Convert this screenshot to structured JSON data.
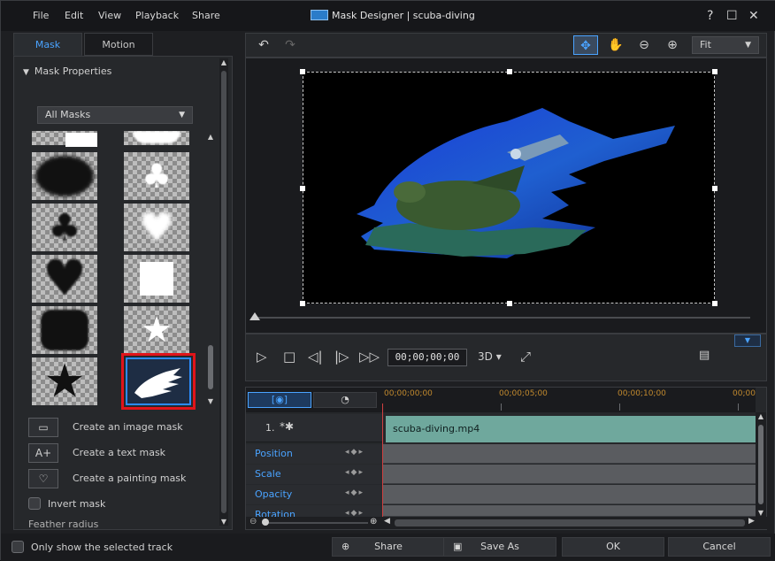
{
  "menu": {
    "file": "File",
    "edit": "Edit",
    "view": "View",
    "playback": "Playback",
    "share": "Share"
  },
  "window": {
    "title": "Mask Designer | scuba-diving",
    "help": "?",
    "maximize": "☐",
    "close": "✕"
  },
  "tabs": {
    "mask": "Mask",
    "motion": "Motion"
  },
  "mask_properties": {
    "title": "Mask Properties",
    "filter": "All Masks",
    "masks": [
      {
        "shape": "bar"
      },
      {
        "shape": "cloud"
      },
      {
        "shape": "oval"
      },
      {
        "shape": "clover"
      },
      {
        "shape": "clover"
      },
      {
        "shape": "heart"
      },
      {
        "shape": "heart"
      },
      {
        "shape": "square"
      },
      {
        "shape": "rounded-square"
      },
      {
        "shape": "star"
      },
      {
        "shape": "star"
      },
      {
        "shape": "brush",
        "selected": true
      }
    ]
  },
  "actions": {
    "image_mask": "Create an image mask",
    "text_mask": "Create a text mask",
    "painting_mask": "Create a painting mask",
    "invert": "Invert mask",
    "feather": "Feather radius"
  },
  "toolbar": {
    "fit": "Fit"
  },
  "playback": {
    "timecode": "00;00;00;00",
    "mode": "3D"
  },
  "timeline": {
    "ruler": [
      "00;00;00;00",
      "00;00;05;00",
      "00;00;10;00",
      "00;00"
    ],
    "track_number": "1.",
    "clip_name": "scuba-diving.mp4",
    "properties": [
      "Position",
      "Scale",
      "Opacity",
      "Rotation"
    ]
  },
  "footer": {
    "only_selected": "Only show the selected track",
    "share": "Share",
    "save_as": "Save As",
    "ok": "OK",
    "cancel": "Cancel"
  },
  "colors": {
    "accent": "#4aa3ff",
    "clip": "#6fa89d",
    "selection": "#e0141a"
  }
}
